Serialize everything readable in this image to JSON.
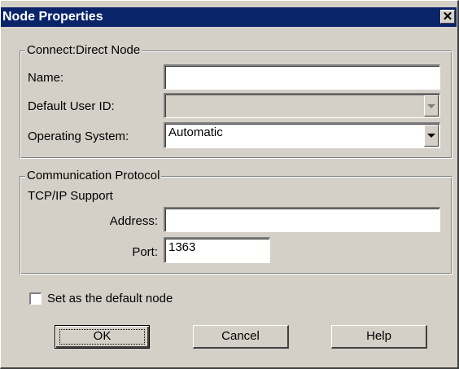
{
  "window": {
    "title": "Node Properties",
    "close_glyph": "✕"
  },
  "connect_group": {
    "legend": "Connect:Direct Node",
    "name_label": "Name:",
    "name_value": "",
    "user_label": "Default User ID:",
    "user_value": "",
    "os_label": "Operating System:",
    "os_value": "Automatic"
  },
  "comm_group": {
    "legend": "Communication Protocol",
    "subheading": "TCP/IP Support",
    "address_label": "Address:",
    "address_value": "",
    "port_label": "Port:",
    "port_value": "1363"
  },
  "default_node": {
    "label": "Set as the default node",
    "checked": false
  },
  "buttons": {
    "ok": "OK",
    "cancel": "Cancel",
    "help": "Help"
  },
  "icons": {
    "close": "close-icon",
    "dropdown": "chevron-down-icon"
  }
}
